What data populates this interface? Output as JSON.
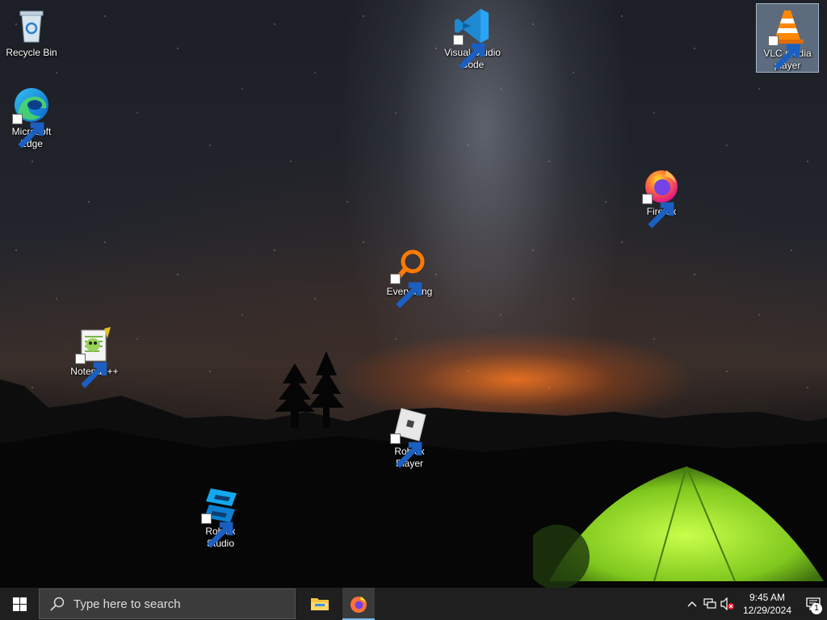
{
  "desktop": {
    "icons": [
      {
        "id": "recycle-bin",
        "label": "Recycle Bin",
        "shortcut": false,
        "selected": false
      },
      {
        "id": "microsoft-edge",
        "label": "Microsoft Edge",
        "shortcut": true,
        "selected": false
      },
      {
        "id": "visual-studio-code",
        "label": "Visual Studio Code",
        "shortcut": true,
        "selected": false
      },
      {
        "id": "vlc-media-player",
        "label": "VLC media player",
        "shortcut": true,
        "selected": true
      },
      {
        "id": "firefox",
        "label": "Firefox",
        "shortcut": true,
        "selected": false
      },
      {
        "id": "everything",
        "label": "Everything",
        "shortcut": true,
        "selected": false
      },
      {
        "id": "notepad-plus-plus",
        "label": "Notepad++",
        "shortcut": true,
        "selected": false
      },
      {
        "id": "roblox-player",
        "label": "Roblox Player",
        "shortcut": true,
        "selected": false
      },
      {
        "id": "roblox-studio",
        "label": "Roblox Studio",
        "shortcut": true,
        "selected": false
      }
    ]
  },
  "taskbar": {
    "search_placeholder": "Type here to search",
    "pinned": [
      {
        "name": "File Explorer",
        "icon": "folder-icon",
        "active": false
      },
      {
        "name": "Firefox",
        "icon": "firefox-icon",
        "active": true
      }
    ],
    "tray": {
      "icons": [
        "chevron-up-icon",
        "network-icon",
        "volume-muted-icon"
      ],
      "time": "9:45 AM",
      "date": "12/29/2024",
      "notification_count": "1"
    }
  },
  "colors": {
    "taskbar_bg": "#1f1f1f",
    "search_bg": "#3b3b3b",
    "accent": "#76b9ed"
  }
}
